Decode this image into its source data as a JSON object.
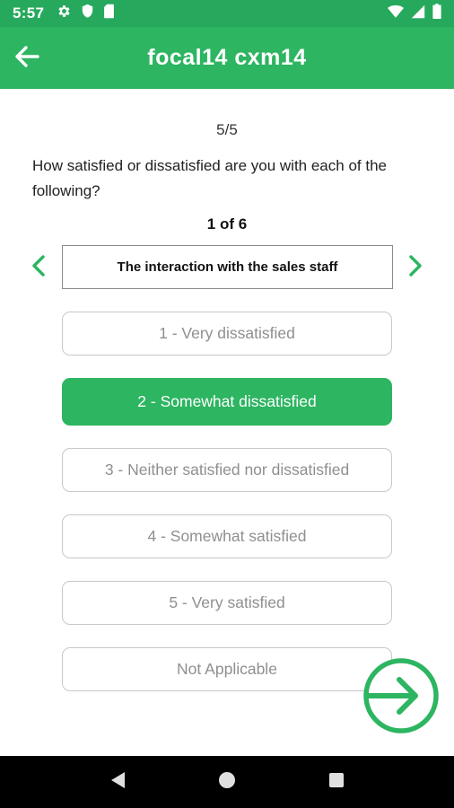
{
  "status_bar": {
    "time": "5:57",
    "left_icons": [
      "gear-icon",
      "shield-icon",
      "sim-card-icon"
    ],
    "right_icons": [
      "wifi-icon",
      "signal-icon",
      "battery-icon"
    ]
  },
  "app_bar": {
    "title": "focal14 cxm14",
    "back_icon": "arrow-left-icon"
  },
  "survey": {
    "progress": "5/5",
    "question": "How satisfied or dissatisfied are you with each of the following?",
    "item_counter": "1 of 6",
    "current_item": "The interaction with the sales staff",
    "options": [
      {
        "label": "1 - Very dissatisfied",
        "selected": false
      },
      {
        "label": "2 - Somewhat dissatisfied",
        "selected": true
      },
      {
        "label": "3 - Neither satisfied nor dissatisfied",
        "selected": false
      },
      {
        "label": "4 - Somewhat satisfied",
        "selected": false
      },
      {
        "label": "5 - Very satisfied",
        "selected": false
      },
      {
        "label": "Not Applicable",
        "selected": false
      }
    ]
  },
  "colors": {
    "primary": "#2db561",
    "status_bar": "#26a95c",
    "option_border": "#c8c8c8",
    "option_text": "#8f8f8f"
  },
  "nav_bar": {
    "buttons": [
      "back-triangle-icon",
      "home-circle-icon",
      "recents-square-icon"
    ]
  }
}
